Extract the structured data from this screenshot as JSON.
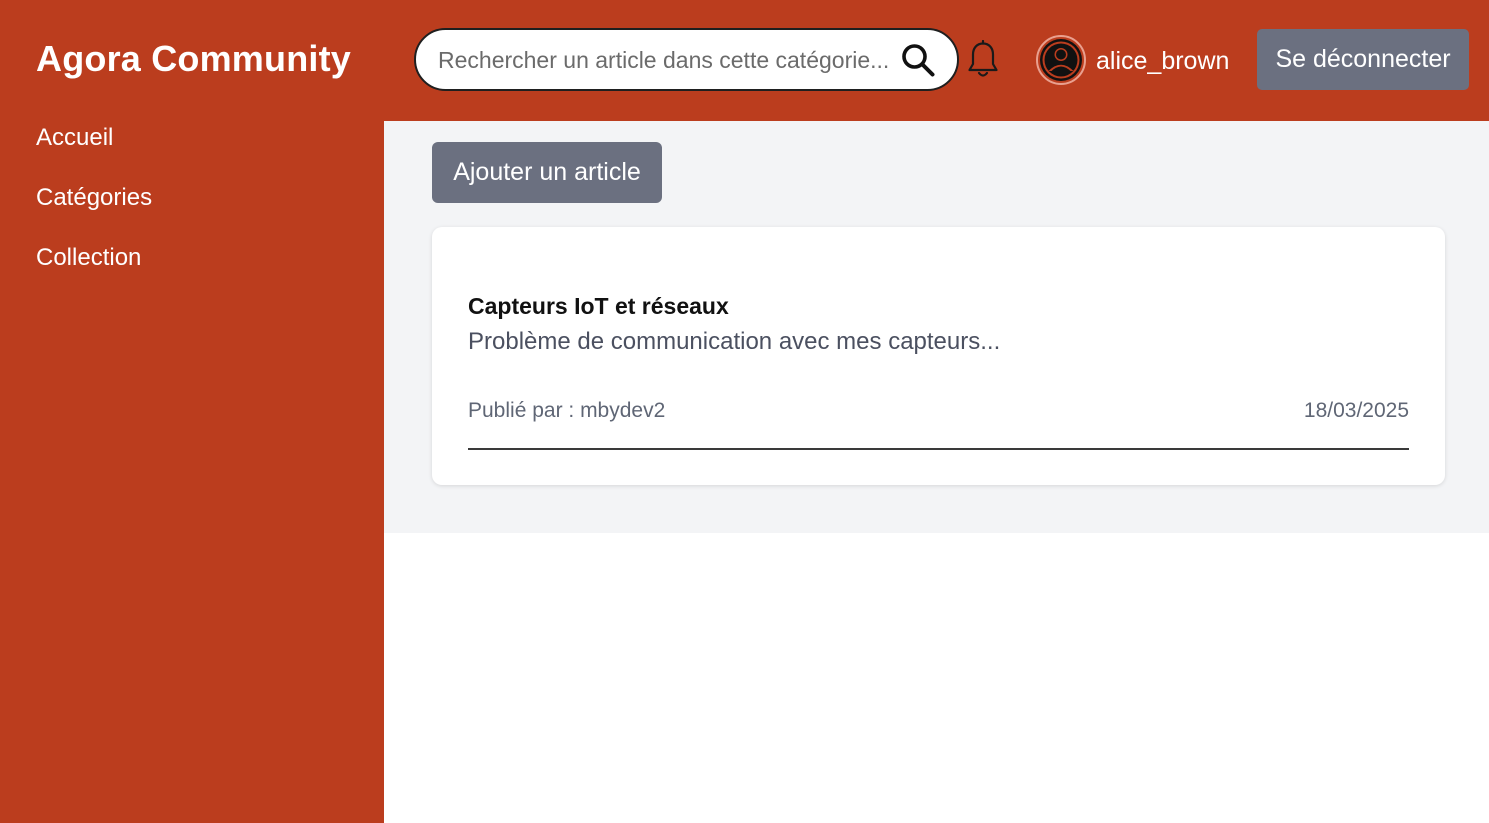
{
  "header": {
    "brand": "Agora Community",
    "search": {
      "placeholder": "Rechercher un article dans cette catégorie...",
      "value": "",
      "icon": "search-icon"
    },
    "notification_icon": "bell-icon",
    "user": {
      "avatar_icon": "user-avatar-icon",
      "username": "alice_brown"
    },
    "logout_label": "Se déconnecter"
  },
  "sidebar": {
    "items": [
      {
        "label": "Accueil"
      },
      {
        "label": "Catégories"
      },
      {
        "label": "Collection"
      }
    ]
  },
  "main": {
    "add_article_label": "Ajouter un article",
    "articles": [
      {
        "title": "Capteurs IoT et réseaux",
        "excerpt": "Problème de communication avec mes capteurs...",
        "author_line": "Publié par : mbydev2",
        "date": "18/03/2025"
      }
    ]
  },
  "colors": {
    "brand": "#bb3d1e",
    "button": "#6b7080",
    "main_bg": "#f3f4f6",
    "card_bg": "#ffffff"
  }
}
